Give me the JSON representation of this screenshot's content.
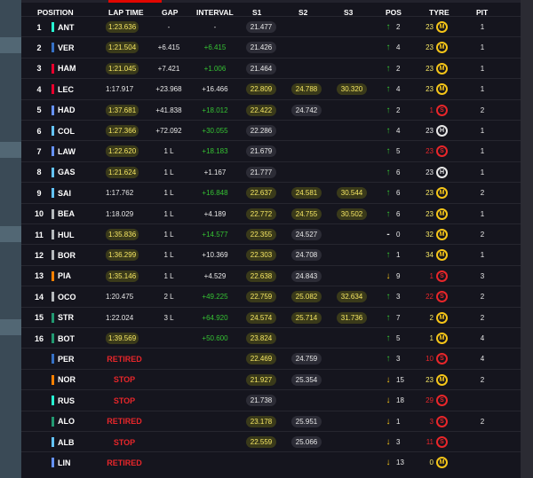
{
  "headers": {
    "position": "POSITION",
    "lap_time": "LAP TIME",
    "gap": "GAP",
    "interval": "INTERVAL",
    "s1": "S1",
    "s2": "S2",
    "s3": "S3",
    "pos": "POS",
    "tyre": "TYRE",
    "pit": "PIT"
  },
  "colors": {
    "background": "#15151e",
    "purple_yellow_highlight": "#f5e663",
    "interval_green": "#35c233",
    "status_red": "#e8262a",
    "medium_tyre": "#f5c518",
    "soft_tyre": "#e8262a",
    "hard_tyre": "#e8e8e8"
  },
  "rows": [
    {
      "pos": "1",
      "team_color": "#27f4d2",
      "code": "ANT",
      "lap": "1:23.636",
      "lap_hl": true,
      "gap": "-",
      "interval": "-",
      "int_color": "white",
      "status": "",
      "s1": "21.477",
      "s1_hl": false,
      "s2": "",
      "s2_hl": false,
      "s3": "",
      "s3_hl": false,
      "dir": "up",
      "change": "2",
      "tyre_laps": "23",
      "laps_color": "#f5e663",
      "tyre": "M",
      "pit": "1"
    },
    {
      "pos": "2",
      "team_color": "#3671c6",
      "code": "VER",
      "lap": "1:21.504",
      "lap_hl": true,
      "gap": "+6.415",
      "interval": "+6.415",
      "int_color": "green",
      "status": "",
      "s1": "21.426",
      "s1_hl": false,
      "s2": "",
      "s2_hl": false,
      "s3": "",
      "s3_hl": false,
      "dir": "up",
      "change": "4",
      "tyre_laps": "23",
      "laps_color": "#f5e663",
      "tyre": "M",
      "pit": "1"
    },
    {
      "pos": "3",
      "team_color": "#e8002d",
      "code": "HAM",
      "lap": "1:21.045",
      "lap_hl": true,
      "gap": "+7.421",
      "interval": "+1.006",
      "int_color": "green",
      "status": "",
      "s1": "21.464",
      "s1_hl": false,
      "s2": "",
      "s2_hl": false,
      "s3": "",
      "s3_hl": false,
      "dir": "up",
      "change": "2",
      "tyre_laps": "23",
      "laps_color": "#f5e663",
      "tyre": "M",
      "pit": "1"
    },
    {
      "pos": "4",
      "team_color": "#e8002d",
      "code": "LEC",
      "lap": "1:17.917",
      "lap_hl": false,
      "gap": "+23.968",
      "interval": "+16.466",
      "int_color": "white",
      "status": "",
      "s1": "22.809",
      "s1_hl": true,
      "s2": "24.788",
      "s2_hl": true,
      "s3": "30.320",
      "s3_hl": true,
      "dir": "up",
      "change": "4",
      "tyre_laps": "23",
      "laps_color": "#f5e663",
      "tyre": "M",
      "pit": "1"
    },
    {
      "pos": "5",
      "team_color": "#6692ff",
      "code": "HAD",
      "lap": "1:37.681",
      "lap_hl": true,
      "gap": "+41.838",
      "interval": "+18.012",
      "int_color": "green",
      "status": "",
      "s1": "22.422",
      "s1_hl": true,
      "s2": "24.742",
      "s2_hl": false,
      "s3": "",
      "s3_hl": false,
      "dir": "up",
      "change": "2",
      "tyre_laps": "1",
      "laps_color": "#e8262a",
      "tyre": "S",
      "pit": "2"
    },
    {
      "pos": "6",
      "team_color": "#64c4ff",
      "code": "COL",
      "lap": "1:27.366",
      "lap_hl": true,
      "gap": "+72.092",
      "interval": "+30.055",
      "int_color": "green",
      "status": "",
      "s1": "22.286",
      "s1_hl": false,
      "s2": "",
      "s2_hl": false,
      "s3": "",
      "s3_hl": false,
      "dir": "up",
      "change": "4",
      "tyre_laps": "23",
      "laps_color": "#e8e8e8",
      "tyre": "H",
      "pit": "1"
    },
    {
      "pos": "7",
      "team_color": "#6692ff",
      "code": "LAW",
      "lap": "1:22.620",
      "lap_hl": true,
      "gap": "1 L",
      "interval": "+18.183",
      "int_color": "green",
      "status": "",
      "s1": "21.679",
      "s1_hl": false,
      "s2": "",
      "s2_hl": false,
      "s3": "",
      "s3_hl": false,
      "dir": "up",
      "change": "5",
      "tyre_laps": "23",
      "laps_color": "#e8262a",
      "tyre": "S",
      "pit": "1"
    },
    {
      "pos": "8",
      "team_color": "#64c4ff",
      "code": "GAS",
      "lap": "1:21.624",
      "lap_hl": true,
      "gap": "1 L",
      "interval": "+1.167",
      "int_color": "white",
      "status": "",
      "s1": "21.777",
      "s1_hl": false,
      "s2": "",
      "s2_hl": false,
      "s3": "",
      "s3_hl": false,
      "dir": "up",
      "change": "6",
      "tyre_laps": "23",
      "laps_color": "#e8e8e8",
      "tyre": "H",
      "pit": "1"
    },
    {
      "pos": "9",
      "team_color": "#64c4ff",
      "code": "SAI",
      "lap": "1:17.762",
      "lap_hl": false,
      "gap": "1 L",
      "interval": "+16.848",
      "int_color": "green",
      "status": "",
      "s1": "22.637",
      "s1_hl": true,
      "s2": "24.581",
      "s2_hl": true,
      "s3": "30.544",
      "s3_hl": true,
      "dir": "up",
      "change": "6",
      "tyre_laps": "23",
      "laps_color": "#f5e663",
      "tyre": "M",
      "pit": "2"
    },
    {
      "pos": "10",
      "team_color": "#b6babd",
      "code": "BEA",
      "lap": "1:18.029",
      "lap_hl": false,
      "gap": "1 L",
      "interval": "+4.189",
      "int_color": "white",
      "status": "",
      "s1": "22.772",
      "s1_hl": true,
      "s2": "24.755",
      "s2_hl": true,
      "s3": "30.502",
      "s3_hl": true,
      "dir": "up",
      "change": "6",
      "tyre_laps": "23",
      "laps_color": "#f5e663",
      "tyre": "M",
      "pit": "1"
    },
    {
      "pos": "11",
      "team_color": "#b6babd",
      "code": "HUL",
      "lap": "1:35.836",
      "lap_hl": true,
      "gap": "1 L",
      "interval": "+14.577",
      "int_color": "green",
      "status": "",
      "s1": "22.355",
      "s1_hl": true,
      "s2": "24.527",
      "s2_hl": false,
      "s3": "",
      "s3_hl": false,
      "dir": "flat",
      "change": "0",
      "tyre_laps": "32",
      "laps_color": "#f5e663",
      "tyre": "M",
      "pit": "2"
    },
    {
      "pos": "12",
      "team_color": "#b6babd",
      "code": "BOR",
      "lap": "1:36.299",
      "lap_hl": true,
      "gap": "1 L",
      "interval": "+10.369",
      "int_color": "white",
      "status": "",
      "s1": "22.303",
      "s1_hl": true,
      "s2": "24.708",
      "s2_hl": false,
      "s3": "",
      "s3_hl": false,
      "dir": "up",
      "change": "1",
      "tyre_laps": "34",
      "laps_color": "#f5e663",
      "tyre": "M",
      "pit": "1"
    },
    {
      "pos": "13",
      "team_color": "#ff8000",
      "code": "PIA",
      "lap": "1:35.146",
      "lap_hl": true,
      "gap": "1 L",
      "interval": "+4.529",
      "int_color": "white",
      "status": "",
      "s1": "22.638",
      "s1_hl": true,
      "s2": "24.843",
      "s2_hl": false,
      "s3": "",
      "s3_hl": false,
      "dir": "down",
      "change": "9",
      "tyre_laps": "1",
      "laps_color": "#e8262a",
      "tyre": "S",
      "pit": "3"
    },
    {
      "pos": "14",
      "team_color": "#b6babd",
      "code": "OCO",
      "lap": "1:20.475",
      "lap_hl": false,
      "gap": "2 L",
      "interval": "+49.225",
      "int_color": "green",
      "status": "",
      "s1": "22.759",
      "s1_hl": true,
      "s2": "25.082",
      "s2_hl": true,
      "s3": "32.634",
      "s3_hl": true,
      "dir": "up",
      "change": "3",
      "tyre_laps": "22",
      "laps_color": "#e8262a",
      "tyre": "S",
      "pit": "2"
    },
    {
      "pos": "15",
      "team_color": "#229971",
      "code": "STR",
      "lap": "1:22.024",
      "lap_hl": false,
      "gap": "3 L",
      "interval": "+64.920",
      "int_color": "green",
      "status": "",
      "s1": "24.574",
      "s1_hl": true,
      "s2": "25.714",
      "s2_hl": true,
      "s3": "31.736",
      "s3_hl": true,
      "dir": "up",
      "change": "7",
      "tyre_laps": "2",
      "laps_color": "#f5e663",
      "tyre": "M",
      "pit": "2"
    },
    {
      "pos": "16",
      "team_color": "#229971",
      "code": "BOT",
      "lap": "1:39.569",
      "lap_hl": true,
      "gap": "",
      "interval": "+50.600",
      "int_color": "green",
      "status": "",
      "s1": "23.824",
      "s1_hl": true,
      "s2": "",
      "s2_hl": false,
      "s3": "",
      "s3_hl": false,
      "dir": "up",
      "change": "5",
      "tyre_laps": "1",
      "laps_color": "#f5e663",
      "tyre": "M",
      "pit": "4"
    },
    {
      "pos": "",
      "team_color": "#3671c6",
      "code": "PER",
      "lap": "",
      "lap_hl": false,
      "gap": "",
      "interval": "",
      "int_color": "white",
      "status": "RETIRED",
      "s1": "22.469",
      "s1_hl": true,
      "s2": "24.759",
      "s2_hl": false,
      "s3": "",
      "s3_hl": false,
      "dir": "up",
      "change": "3",
      "tyre_laps": "10",
      "laps_color": "#e8262a",
      "tyre": "S",
      "pit": "4"
    },
    {
      "pos": "",
      "team_color": "#ff8000",
      "code": "NOR",
      "lap": "",
      "lap_hl": false,
      "gap": "",
      "interval": "",
      "int_color": "white",
      "status": "STOP",
      "s1": "21.927",
      "s1_hl": true,
      "s2": "25.354",
      "s2_hl": false,
      "s3": "",
      "s3_hl": false,
      "dir": "down",
      "change": "15",
      "tyre_laps": "23",
      "laps_color": "#f5e663",
      "tyre": "M",
      "pit": "2"
    },
    {
      "pos": "",
      "team_color": "#27f4d2",
      "code": "RUS",
      "lap": "",
      "lap_hl": false,
      "gap": "",
      "interval": "",
      "int_color": "white",
      "status": "STOP",
      "s1": "21.738",
      "s1_hl": false,
      "s2": "",
      "s2_hl": false,
      "s3": "",
      "s3_hl": false,
      "dir": "down",
      "change": "18",
      "tyre_laps": "29",
      "laps_color": "#e8262a",
      "tyre": "S",
      "pit": ""
    },
    {
      "pos": "",
      "team_color": "#229971",
      "code": "ALO",
      "lap": "",
      "lap_hl": false,
      "gap": "",
      "interval": "",
      "int_color": "white",
      "status": "RETIRED",
      "s1": "23.178",
      "s1_hl": true,
      "s2": "25.951",
      "s2_hl": false,
      "s3": "",
      "s3_hl": false,
      "dir": "down",
      "change": "1",
      "tyre_laps": "3",
      "laps_color": "#e8262a",
      "tyre": "S",
      "pit": "2"
    },
    {
      "pos": "",
      "team_color": "#64c4ff",
      "code": "ALB",
      "lap": "",
      "lap_hl": false,
      "gap": "",
      "interval": "",
      "int_color": "white",
      "status": "STOP",
      "s1": "22.559",
      "s1_hl": true,
      "s2": "25.066",
      "s2_hl": false,
      "s3": "",
      "s3_hl": false,
      "dir": "down",
      "change": "3",
      "tyre_laps": "11",
      "laps_color": "#e8262a",
      "tyre": "S",
      "pit": ""
    },
    {
      "pos": "",
      "team_color": "#6692ff",
      "code": "LIN",
      "lap": "",
      "lap_hl": false,
      "gap": "",
      "interval": "",
      "int_color": "white",
      "status": "RETIRED",
      "s1": "",
      "s1_hl": false,
      "s2": "",
      "s2_hl": false,
      "s3": "",
      "s3_hl": false,
      "dir": "down",
      "change": "13",
      "tyre_laps": "0",
      "laps_color": "#f5e663",
      "tyre": "M",
      "pit": ""
    }
  ]
}
